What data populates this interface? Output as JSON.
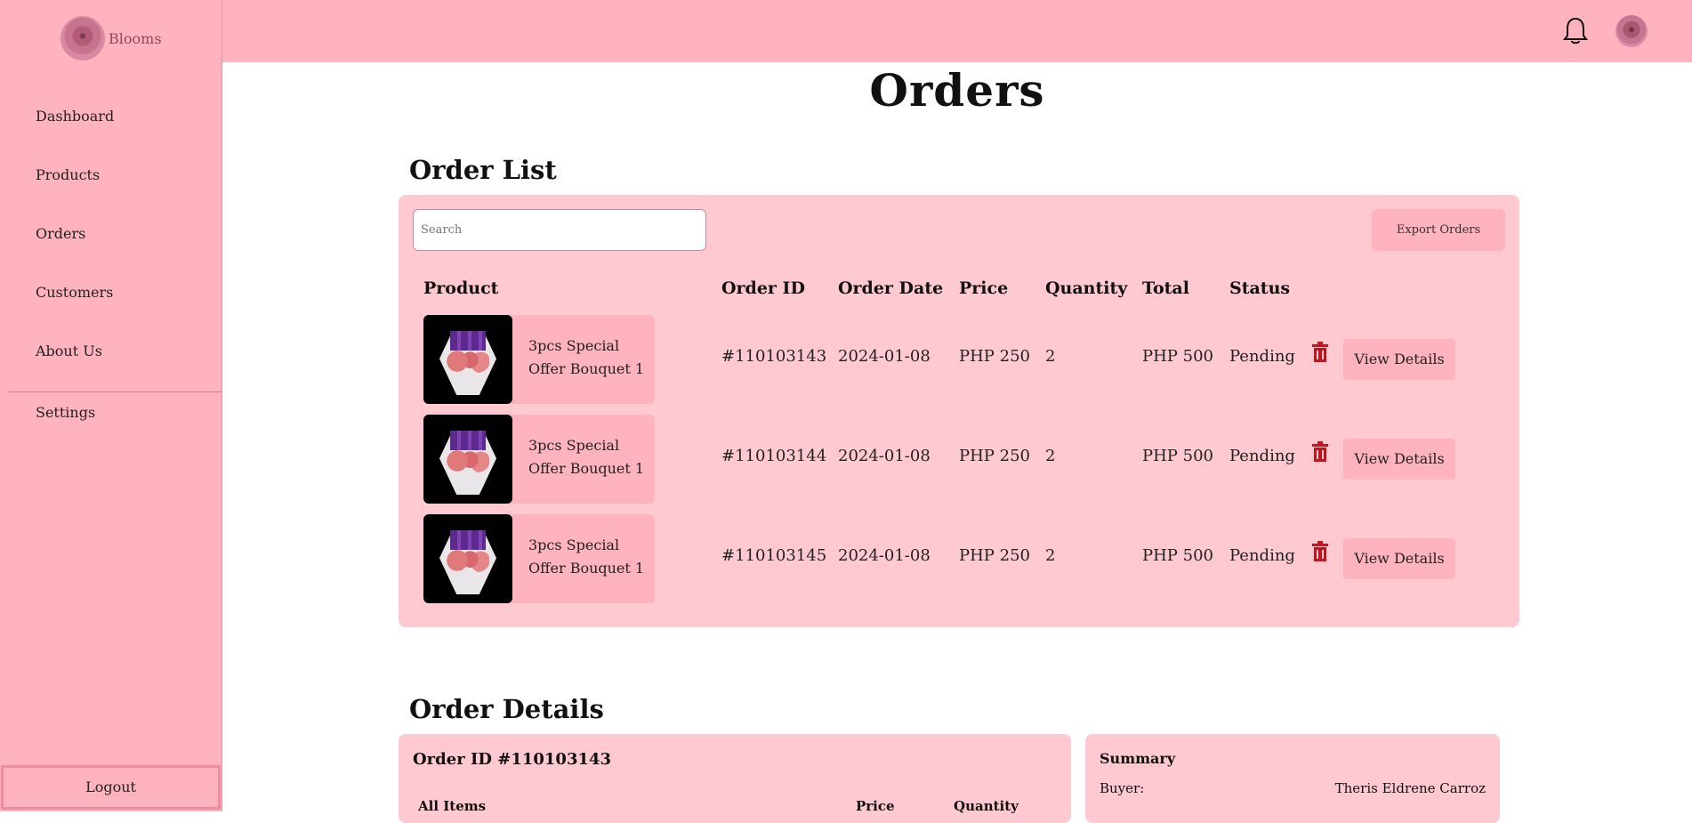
{
  "brand": {
    "name": "Blooms"
  },
  "sidebar": {
    "items": [
      {
        "label": "Dashboard"
      },
      {
        "label": "Products"
      },
      {
        "label": "Orders"
      },
      {
        "label": "Customers"
      },
      {
        "label": "About Us"
      },
      {
        "label": "Settings"
      }
    ],
    "logout_label": "Logout"
  },
  "header": {
    "icons": [
      "bell-icon",
      "avatar"
    ]
  },
  "page": {
    "title": "Orders"
  },
  "order_list": {
    "title": "Order List",
    "search_placeholder": "Search",
    "export_label": "Export Orders",
    "columns": [
      "Product",
      "Order ID",
      "Order Date",
      "Price",
      "Quantity",
      "Total",
      "Status"
    ],
    "rows": [
      {
        "product": "3pcs Special Offer Bouquet 1",
        "order_id": "#110103143",
        "date": "2024-01-08",
        "price": "PHP 250",
        "quantity": "2",
        "total": "PHP 500",
        "status": "Pending",
        "action": "View Details"
      },
      {
        "product": "3pcs Special Offer Bouquet 1",
        "order_id": "#110103144",
        "date": "2024-01-08",
        "price": "PHP 250",
        "quantity": "2",
        "total": "PHP 500",
        "status": "Pending",
        "action": "View Details"
      },
      {
        "product": "3pcs Special Offer Bouquet 1",
        "order_id": "#110103145",
        "date": "2024-01-08",
        "price": "PHP 250",
        "quantity": "2",
        "total": "PHP 500",
        "status": "Pending",
        "action": "View Details"
      }
    ]
  },
  "order_details": {
    "title": "Order Details",
    "order_id_label": "Order ID #110103143",
    "columns": [
      "All Items",
      "Price",
      "Quantity"
    ],
    "summary": {
      "title": "Summary",
      "buyer_label": "Buyer:",
      "buyer_value": "Theris Eldrene Carroz"
    }
  },
  "colors": {
    "sidebar": "#ffb3bf",
    "panel": "#ffc9d2",
    "trash": "#c0141e"
  }
}
